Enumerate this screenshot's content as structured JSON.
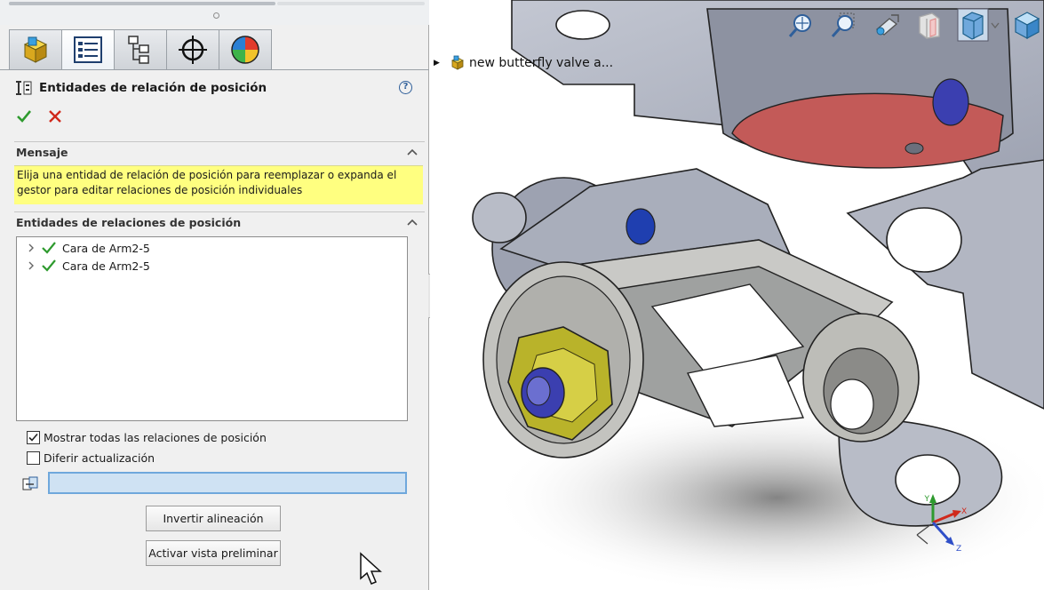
{
  "panel": {
    "tabs": [
      {
        "name": "featuremanager-tab-icon",
        "active": false
      },
      {
        "name": "propertymanager-tab-icon",
        "active": true
      },
      {
        "name": "configurationmanager-tab-icon",
        "active": false
      },
      {
        "name": "dimxpert-tab-icon",
        "active": false
      },
      {
        "name": "appearance-tab-icon",
        "active": false
      }
    ],
    "title": "Entidades de relación de posición",
    "help_icon": "?",
    "message_section": {
      "header": "Mensaje",
      "text": "Elija una entidad de relación de posición para reemplazar o expanda el gestor para editar relaciones de posición individuales"
    },
    "entities_section": {
      "header": "Entidades de relaciones de posición",
      "items": [
        {
          "label": "Cara de Arm2-5"
        },
        {
          "label": "Cara de Arm2-5"
        }
      ]
    },
    "options": {
      "show_all_label": "Mostrar todas las relaciones de posición",
      "show_all_checked": true,
      "defer_label": "Diferir actualización",
      "defer_checked": false
    },
    "mate_input_value": "",
    "buttons": {
      "flip_alignment": "Invertir alineación",
      "preview": "Activar vista preliminar"
    }
  },
  "viewport": {
    "tree_node_label": "new butterfly valve a...",
    "toolbar_icons": [
      "zoom-to-fit-icon",
      "zoom-to-area-icon",
      "previous-view-icon",
      "section-view-icon",
      "view-orientation-icon",
      "display-style-icon"
    ],
    "triad_labels": {
      "x": "X",
      "y": "Y",
      "z": "Z"
    }
  },
  "colors": {
    "panel_bg": "#f0f0f0",
    "message_bg": "#ffff80",
    "input_bg": "#cfe2f3",
    "ok_green": "#2e9a2e",
    "cancel_red": "#d0281b",
    "model_gray": "#b8bcc7",
    "model_face_red": "#c35a58",
    "nut_yellow": "#b9b32a",
    "pin_blue": "#3b3fb0"
  }
}
